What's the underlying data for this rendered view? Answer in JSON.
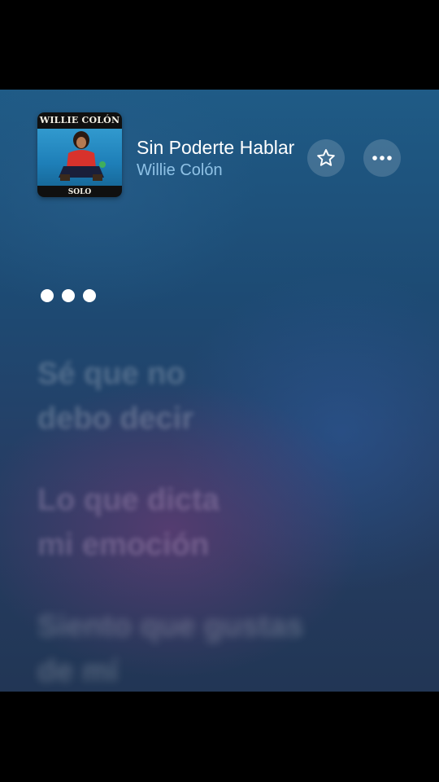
{
  "now_playing": {
    "album_art": {
      "artist_text": "WILLIE COLÓN",
      "album_text": "SOLO"
    },
    "title": "Sin Poderte Hablar",
    "artist": "Willie Colón",
    "star_icon": "star-outline-icon",
    "more_icon": "ellipsis-icon"
  },
  "lyrics": {
    "interlude_indicator": "ellipsis",
    "lines": [
      "Sé que no\ndebo decir",
      "Lo que dicta\nmi emoción",
      "Siento que gustas\nde mí"
    ]
  },
  "colors": {
    "artist_text": "#8fc2e6",
    "background_top": "#1f5b86",
    "background_bottom": "#223655"
  }
}
